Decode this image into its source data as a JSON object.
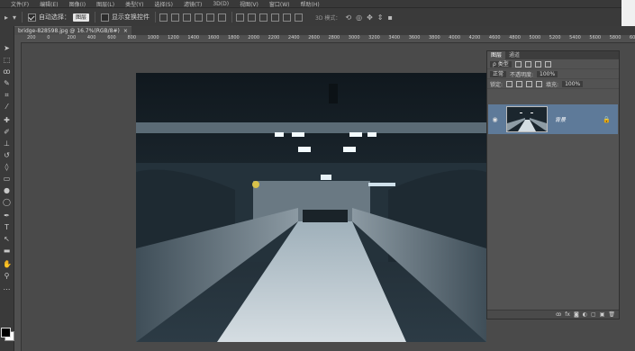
{
  "menubar": {
    "items": [
      "文件(F)",
      "编辑(E)",
      "图像(I)",
      "图层(L)",
      "类型(Y)",
      "选择(S)",
      "滤镜(T)",
      "3D(D)",
      "视图(V)",
      "窗口(W)",
      "帮助(H)"
    ]
  },
  "options": {
    "auto_select_label": "自动选择：",
    "auto_select_value": "图层",
    "show_transform_label": "显示变换控件",
    "mode_3d_label": "3D 模式："
  },
  "document_tab": {
    "title": "bridge-828598.jpg @ 16.7%(RGB/8#)",
    "close": "×"
  },
  "ruler": {
    "ticks": [
      "200",
      "0",
      "200",
      "400",
      "600",
      "800",
      "1000",
      "1200",
      "1400",
      "1600",
      "1800",
      "2000",
      "2200",
      "2400",
      "2600",
      "2800",
      "3000",
      "3200",
      "3400",
      "3600",
      "3800",
      "4000",
      "4200",
      "4600",
      "4800",
      "5000",
      "5200",
      "5400",
      "5600",
      "5800",
      "6000"
    ]
  },
  "layers_panel": {
    "tab_layers": "图层",
    "tab_channels": "通道",
    "filter_kind": "ρ 类型",
    "blend_mode": "正常",
    "opacity_label": "不透明度:",
    "opacity_value": "100%",
    "lock_label": "锁定:",
    "fill_label": "填充:",
    "fill_value": "100%",
    "layer_name": "背景",
    "eye": "◉",
    "lock_icon": "🔒",
    "bottom_icons": [
      "ꝏ",
      "fx",
      "◙",
      "◐",
      "▢",
      "▣",
      "🗑"
    ]
  },
  "colors": {
    "selected_layer": "#5e7a99",
    "panel_bg": "#535353",
    "workspace_bg": "#4a4a4a"
  }
}
